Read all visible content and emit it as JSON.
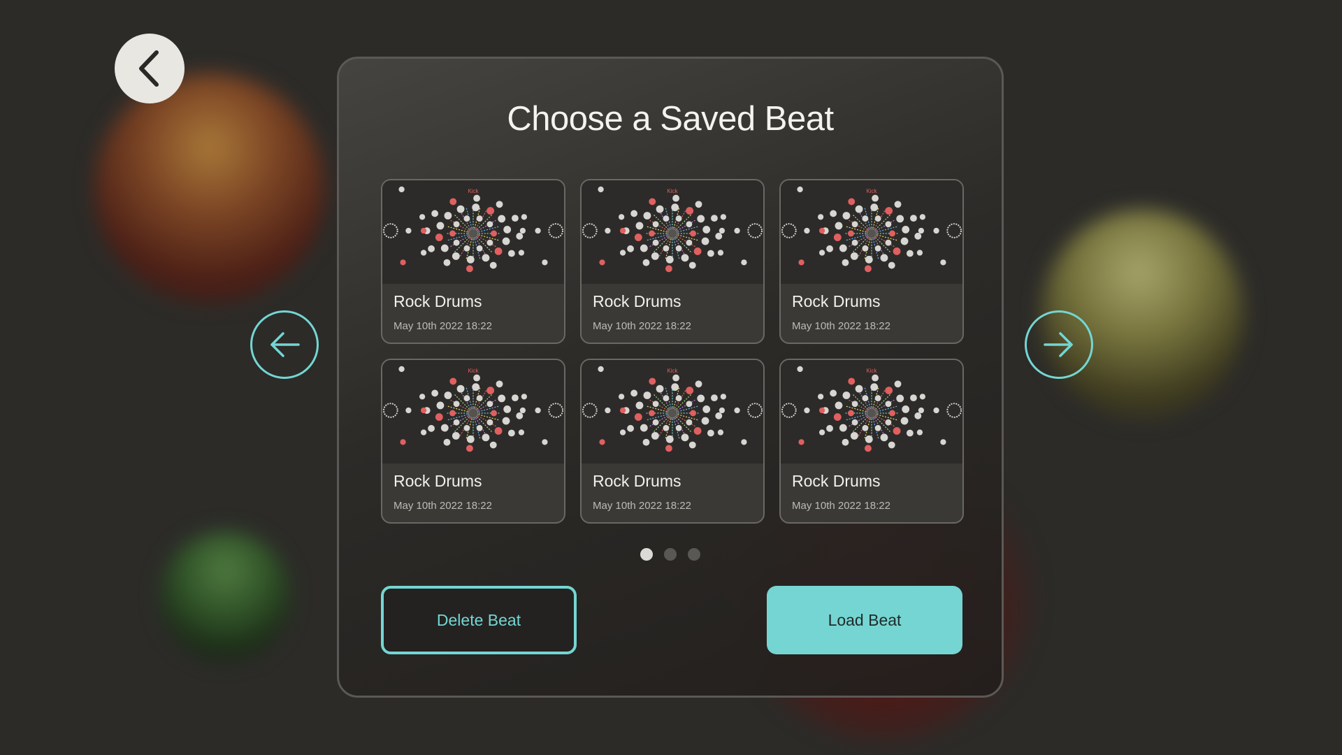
{
  "navigation": {
    "back_icon": "chevron-left-icon",
    "prev_icon": "arrow-left-icon",
    "next_icon": "arrow-right-icon"
  },
  "panel": {
    "title": "Choose a Saved Beat"
  },
  "beats": [
    {
      "name": "Rock Drums",
      "date": "May 10th 2022 18:22",
      "thumb_label": "Kick"
    },
    {
      "name": "Rock Drums",
      "date": "May 10th 2022 18:22",
      "thumb_label": "Kick"
    },
    {
      "name": "Rock Drums",
      "date": "May 10th 2022 18:22",
      "thumb_label": "Kick"
    },
    {
      "name": "Rock Drums",
      "date": "May 10th 2022 18:22",
      "thumb_label": "Kick"
    },
    {
      "name": "Rock Drums",
      "date": "May 10th 2022 18:22",
      "thumb_label": "Kick"
    },
    {
      "name": "Rock Drums",
      "date": "May 10th 2022 18:22",
      "thumb_label": "Kick"
    }
  ],
  "pagination": {
    "pages": 3,
    "current": 1
  },
  "actions": {
    "delete_label": "Delete Beat",
    "load_label": "Load Beat"
  },
  "colors": {
    "accent": "#74d6d3",
    "background": "#2c2b28",
    "thumb_red": "#e06060",
    "thumb_white": "#d8d6d2"
  }
}
